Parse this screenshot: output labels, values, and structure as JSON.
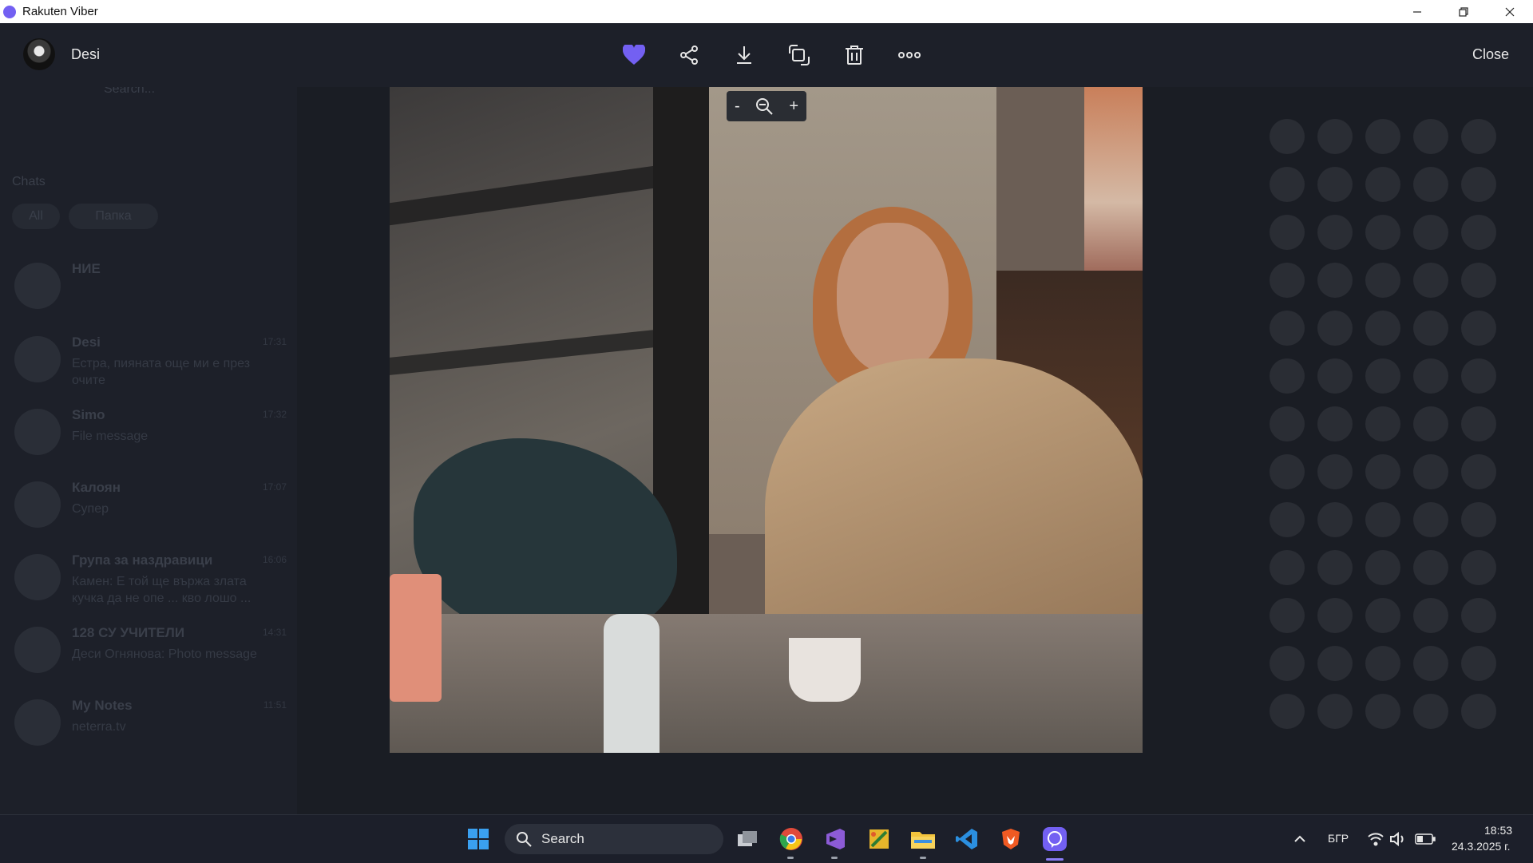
{
  "window": {
    "title": "Rakuten Viber"
  },
  "viewer": {
    "contact_name": "Desi",
    "close_label": "Close",
    "tools": [
      "heart-icon",
      "share-icon",
      "download-icon",
      "rotate-icon",
      "trash-icon",
      "more-icon"
    ],
    "zoom": {
      "minus": "-",
      "plus": "+"
    }
  },
  "background": {
    "search_placeholder": "Search...",
    "chats_header": "Chats",
    "filter_all": "All",
    "filter_folder": "Папка",
    "chats": [
      {
        "name": "НИЕ",
        "time": "",
        "message": ""
      },
      {
        "name": "Desi",
        "time": "17:31",
        "message": "Естра, пияната още ми е през очите"
      },
      {
        "name": "Simo",
        "time": "17:32",
        "message": "File message"
      },
      {
        "name": "Калоян",
        "time": "17:07",
        "message": "Супер"
      },
      {
        "name": "Група за наздравици",
        "time": "16:06",
        "message": "Камен: Е той ще вържа злата кучка да не опе ... кво лошо ..."
      },
      {
        "name": "128 СУ УЧИТЕЛИ",
        "time": "14:31",
        "message": "Деси Огнянова: Photo message"
      },
      {
        "name": "My Notes",
        "time": "11:51",
        "message": "neterra.tv"
      }
    ]
  },
  "taskbar": {
    "search_label": "Search",
    "language": "БГР",
    "time": "18:53",
    "date": "24.3.2025 г."
  },
  "colors": {
    "accent": "#7360f2",
    "background": "#1a1d24"
  }
}
